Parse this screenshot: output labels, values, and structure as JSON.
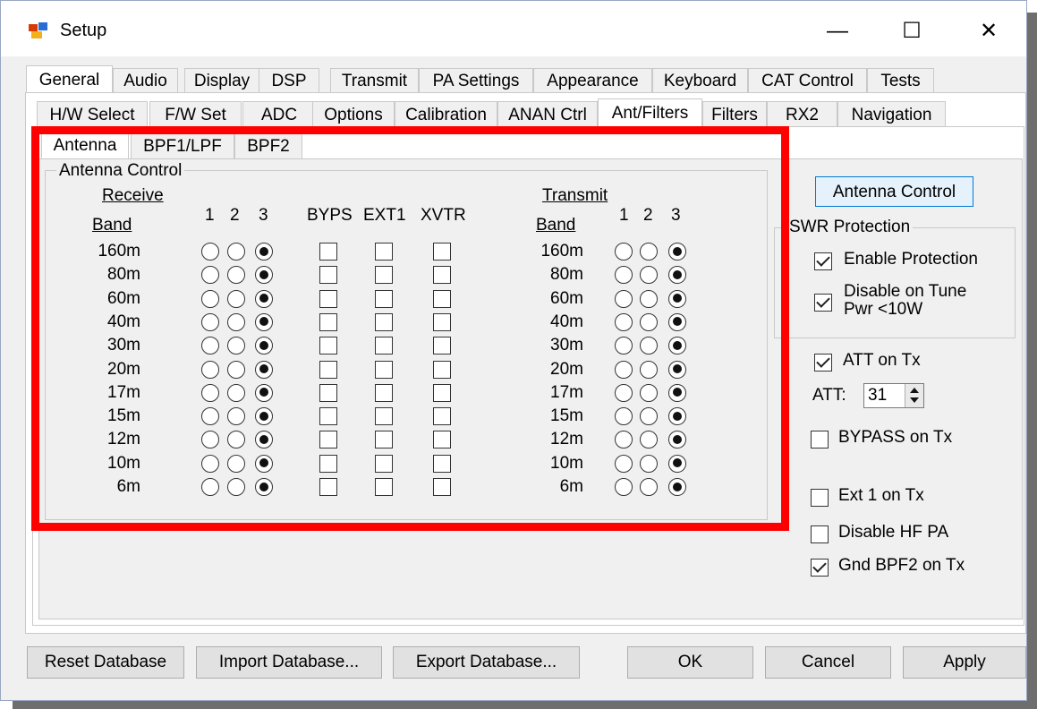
{
  "window": {
    "title": "Setup",
    "controls": {
      "minimize": "—",
      "maximize": "☐",
      "close": "✕"
    }
  },
  "main_tabs": [
    "General",
    "Audio",
    "Display",
    "DSP",
    "Transmit",
    "PA Settings",
    "Appearance",
    "Keyboard",
    "CAT Control",
    "Tests"
  ],
  "general_tabs": [
    "H/W Select",
    "F/W Set",
    "ADC",
    "Options",
    "Calibration",
    "ANAN Ctrl",
    "Ant/Filters",
    "Filters",
    "RX2",
    "Navigation"
  ],
  "ant_tabs": [
    "Antenna",
    "BPF1/LPF",
    "BPF2"
  ],
  "antenna_control": {
    "group_title": "Antenna Control",
    "receive": {
      "title": "Receive",
      "band_header": "Band",
      "ant_headers": [
        "1",
        "2",
        "3"
      ],
      "extra_headers": [
        "BYPS",
        "EXT1",
        "XVTR"
      ]
    },
    "transmit": {
      "title": "Transmit",
      "band_header": "Band",
      "ant_headers": [
        "1",
        "2",
        "3"
      ]
    },
    "bands": [
      "160m",
      "80m",
      "60m",
      "40m",
      "30m",
      "20m",
      "17m",
      "15m",
      "12m",
      "10m",
      "6m"
    ],
    "rx_selected_antenna": [
      3,
      3,
      3,
      3,
      3,
      3,
      3,
      3,
      3,
      3,
      3
    ],
    "tx_selected_antenna": [
      3,
      3,
      3,
      3,
      3,
      3,
      3,
      3,
      3,
      3,
      3
    ],
    "rx_byps": [
      false,
      false,
      false,
      false,
      false,
      false,
      false,
      false,
      false,
      false,
      false
    ],
    "rx_ext1": [
      false,
      false,
      false,
      false,
      false,
      false,
      false,
      false,
      false,
      false,
      false
    ],
    "rx_xvtr": [
      false,
      false,
      false,
      false,
      false,
      false,
      false,
      false,
      false,
      false,
      false
    ]
  },
  "right_panel": {
    "antenna_control_button": "Antenna Control",
    "swr_group_title": "SWR Protection",
    "enable_protection": {
      "label": "Enable Protection",
      "checked": true
    },
    "disable_on_tune": {
      "label_line1": "Disable on Tune",
      "label_line2": "Pwr <10W",
      "checked": true
    },
    "att_on_tx": {
      "label": "ATT on Tx",
      "checked": true
    },
    "att": {
      "label": "ATT:",
      "value": "31"
    },
    "bypass_on_tx": {
      "label": "BYPASS on Tx",
      "checked": false
    },
    "ext1_on_tx": {
      "label": "Ext 1 on Tx",
      "checked": false
    },
    "disable_hf_pa": {
      "label": "Disable HF PA",
      "checked": false
    },
    "gnd_bpf2_on_tx": {
      "label": "Gnd BPF2 on Tx",
      "checked": true
    }
  },
  "buttons": {
    "reset": "Reset Database",
    "import": "Import Database...",
    "export": "Export Database...",
    "ok": "OK",
    "cancel": "Cancel",
    "apply": "Apply"
  },
  "colors": {
    "highlight": "#ff0000",
    "accent": "#0078d7"
  }
}
